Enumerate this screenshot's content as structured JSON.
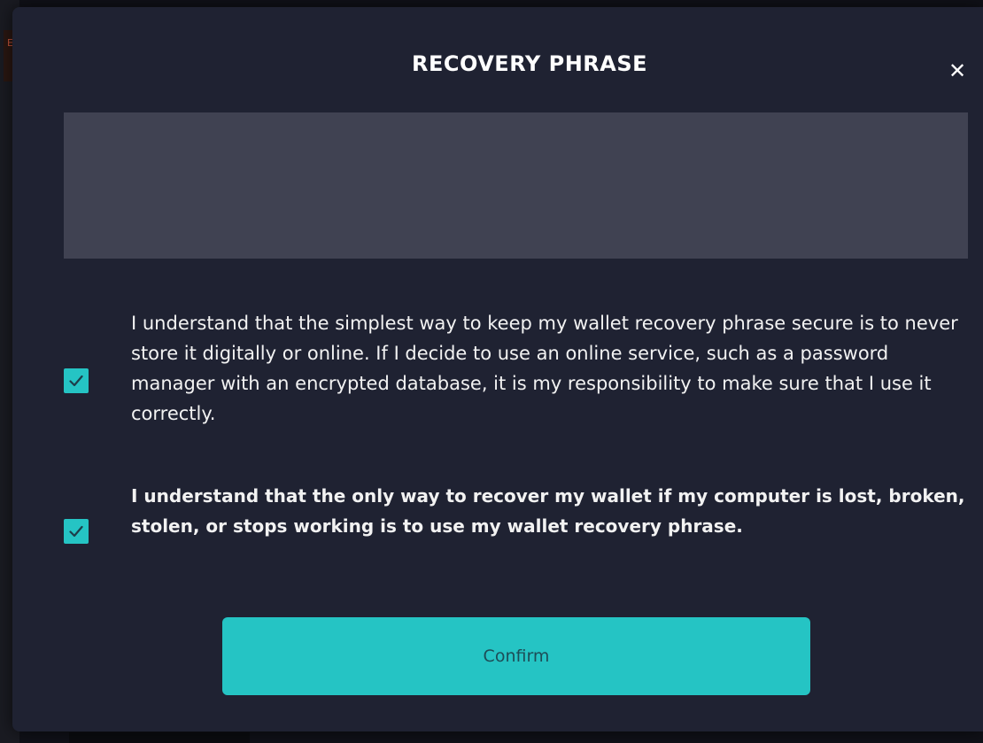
{
  "background": {
    "edge_tag": "E"
  },
  "modal": {
    "title": "RECOVERY PHRASE",
    "close_glyph": "✕",
    "phrase_value": "",
    "acknowledgements": [
      {
        "text": "I understand that the simplest way to keep my wallet recovery phrase secure is to never store it digitally or online. If I decide to use an online service, such as a password manager with an encrypted database, it is my responsibility to make sure that I use it correctly.",
        "checked": true
      },
      {
        "text": "I understand that the only way to recover my wallet if my computer is lost, broken, stolen, or stops working is to use my wallet recovery phrase.",
        "checked": true
      }
    ],
    "confirm_label": "Confirm"
  },
  "icons": {
    "close": "close-icon",
    "checkmark": "checkmark-icon"
  },
  "colors": {
    "modal_bg": "#1f2232",
    "phrase_box_bg": "#404252",
    "accent": "#25c4c4",
    "confirm_text": "#1d4d57",
    "text": "#f2f2f2"
  }
}
